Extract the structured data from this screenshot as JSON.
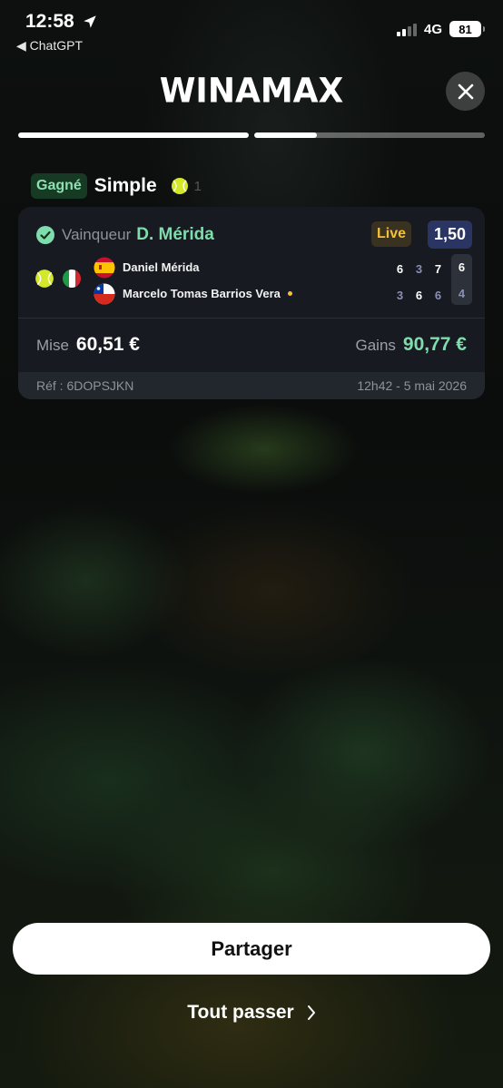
{
  "status_bar": {
    "time": "12:58",
    "back_app": "◀ ChatGPT",
    "network": "4G",
    "battery": "81"
  },
  "header": {
    "logo": "WINAMAX",
    "progress": [
      1.0,
      0.27
    ]
  },
  "bet": {
    "status_label": "Gagné",
    "type_label": "Simple",
    "count": "1",
    "selection_label": "Vainqueur",
    "selection_name": "D. Mérida",
    "live_label": "Live",
    "odds": "1,50",
    "players": [
      {
        "name": "Daniel Mérida",
        "flag": "spain",
        "sets": [
          "6",
          "3",
          "7"
        ],
        "current": "6"
      },
      {
        "name": "Marcelo Tomas Barrios Vera",
        "flag": "chile",
        "sets": [
          "3",
          "6",
          "6"
        ],
        "current": "4"
      }
    ],
    "stake_label": "Mise",
    "stake_value": "60,51 €",
    "gain_label": "Gains",
    "gain_value": "90,77 €",
    "ref": "Réf : 6DOPSJKN",
    "date": "12h42 - 5 mai 2026"
  },
  "actions": {
    "share_label": "Partager",
    "skip_label": "Tout passer"
  },
  "colors": {
    "accent_green": "#7fdcac",
    "live_yellow": "#f5c035",
    "odds_bg": "#2a3563"
  },
  "icons": [
    "location-arrow-icon",
    "signal-icon",
    "battery-icon",
    "close-icon",
    "check-circle-icon",
    "tennis-ball-icon",
    "italy-flag-icon",
    "spain-flag-icon",
    "chile-flag-icon",
    "chevron-right-icon"
  ]
}
